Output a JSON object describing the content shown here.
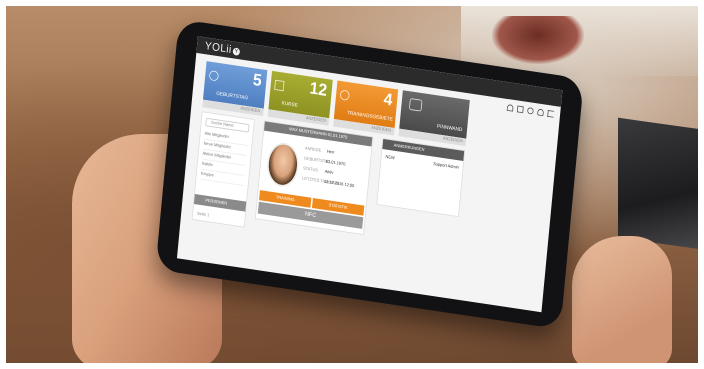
{
  "app": {
    "logo_text": "YOLii",
    "logo_mark": "Y"
  },
  "toolbar": {
    "icons": [
      "home-icon",
      "folder-icon",
      "globe-icon",
      "user-icon",
      "logout-icon"
    ]
  },
  "tiles": [
    {
      "value": "5",
      "label": "GEBURTSTAG",
      "footer": "ANZEIGEN",
      "color": "#5a89c9",
      "icon": "user-icon"
    },
    {
      "value": "12",
      "label": "KURSE",
      "footer": "ANZEIGEN",
      "color": "#9aa02a",
      "icon": "calendar-icon"
    },
    {
      "value": "4",
      "label": "TRAININGSGEBIETE",
      "footer": "ANZEIGEN",
      "color": "#ea8a1e",
      "icon": "head-icon"
    },
    {
      "value": "",
      "label": "PINNWAND",
      "footer": "ANZEIGEN",
      "color": "#585858",
      "icon": "chat-icon"
    }
  ],
  "left_panel": {
    "search_placeholder": "Suche Name",
    "items": [
      "Alle Mitglieder",
      "Neue Mitglieder",
      "Aktive Mitglieder",
      "Inaktiv",
      "Gruppe"
    ],
    "footer_label": "PERSONEN ANLEGEN",
    "bottom_text": "Seite 1"
  },
  "member_card": {
    "header": "MAX MUSTERMANN 01.01.1970",
    "rows": [
      {
        "label": "ANREDE",
        "value": "Herr"
      },
      {
        "label": "GEBURTSTAG",
        "value": "01.01.1970"
      },
      {
        "label": "STATUS",
        "value": "Aktiv"
      },
      {
        "label": "LETZTES TRAINING",
        "value": "12.12.2016 12:00"
      }
    ],
    "buttons": [
      "TRAINING",
      "STATISTIK"
    ],
    "nfc_label": "NFC"
  },
  "notes": {
    "header": "ANMERKUNGEN",
    "rows": [
      {
        "left": "NEW",
        "right": "Support Admin"
      }
    ]
  }
}
